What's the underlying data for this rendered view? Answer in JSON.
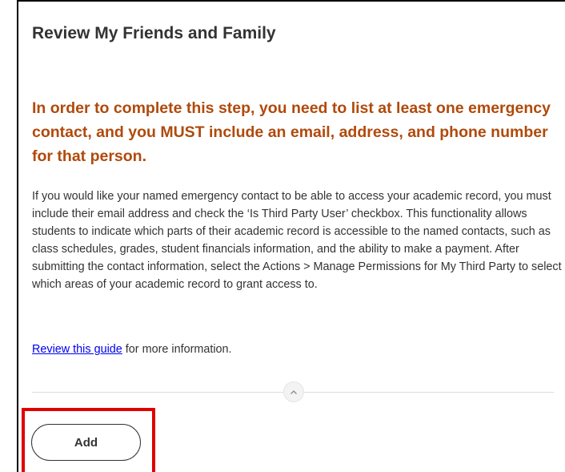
{
  "page": {
    "title": "Review My Friends and Family",
    "notice": "In order to complete this step, you need to list at least one emergency contact, and you MUST include an email, address, and phone number for that person.",
    "body": "If you would like your named emergency contact to be able to access your academic record, you must include their email address and check the ‘Is Third Party User’ checkbox. This functionality allows students to indicate which parts of their academic record is accessible to the named contacts, such as class schedules, grades, student financials information, and the ability to make a payment.  After submitting the contact information, select the Actions > Manage Permissions for My Third Party to select which areas of your academic record to grant access to.",
    "guide_link": "Review this guide",
    "guide_suffix": " for more information."
  },
  "actions": {
    "collapse_icon": "chevron-up-icon",
    "add_label": "Add"
  },
  "colors": {
    "notice": "#b04a0b",
    "link": "#0000ee",
    "highlight": "#e00000"
  }
}
